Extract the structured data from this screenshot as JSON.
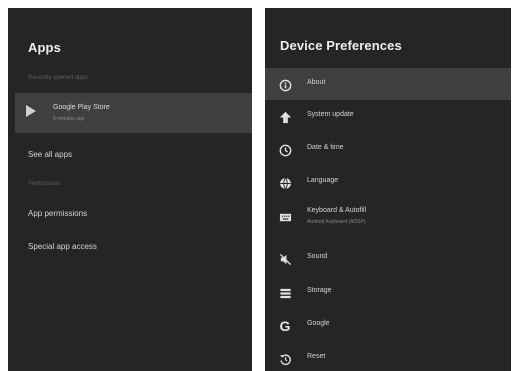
{
  "apps_panel": {
    "title": "Apps",
    "recent_header": "Recently opened apps",
    "recent_app": {
      "name": "Google Play Store",
      "subtitle": "5 minutes ago"
    },
    "see_all": "See all apps",
    "permissions_header": "Permissions",
    "app_permissions": "App permissions",
    "special_access": "Special app access"
  },
  "prefs_panel": {
    "title": "Device Preferences",
    "items": [
      {
        "label": "About",
        "icon": "info-icon"
      },
      {
        "label": "System update",
        "icon": "upload-arrow-icon"
      },
      {
        "label": "Date & time",
        "icon": "clock-icon"
      },
      {
        "label": "Language",
        "icon": "globe-icon"
      },
      {
        "label": "Keyboard & Autofill",
        "sub": "Android Keyboard (AOSP)",
        "icon": "keyboard-icon"
      },
      {
        "label": "Sound",
        "icon": "speaker-off-icon"
      },
      {
        "label": "Storage",
        "icon": "storage-icon"
      },
      {
        "label": "Google",
        "icon": "google-icon"
      },
      {
        "label": "Reset",
        "icon": "reset-icon"
      }
    ]
  }
}
